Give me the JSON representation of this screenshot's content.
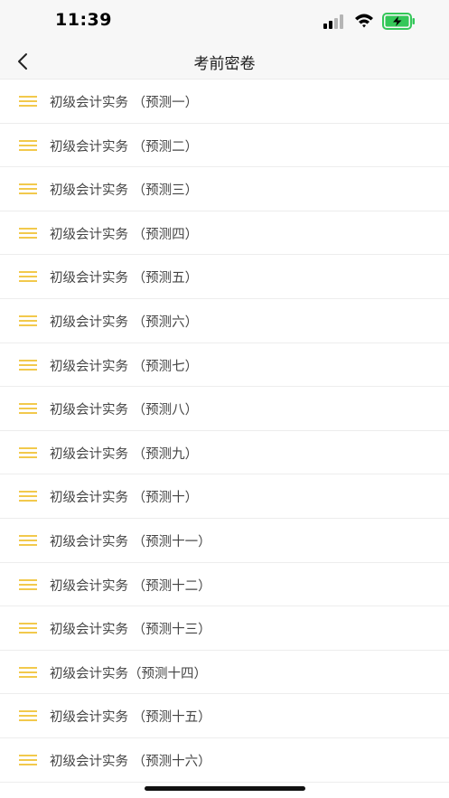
{
  "status_bar": {
    "time": "11:39",
    "icons": [
      "signal-icon",
      "wifi-icon",
      "battery-charging-icon"
    ],
    "battery_color": "#34c759"
  },
  "nav": {
    "back_icon": "chevron-left-icon",
    "title": "考前密卷"
  },
  "list": {
    "icon": "menu-lines-icon",
    "accent_color": "#f2c94c",
    "items": [
      {
        "label": "初级会计实务 （预测一）"
      },
      {
        "label": "初级会计实务 （预测二）"
      },
      {
        "label": "初级会计实务 （预测三）"
      },
      {
        "label": "初级会计实务 （预测四）"
      },
      {
        "label": "初级会计实务 （预测五）"
      },
      {
        "label": "初级会计实务 （预测六）"
      },
      {
        "label": "初级会计实务 （预测七）"
      },
      {
        "label": "初级会计实务 （预测八）"
      },
      {
        "label": "初级会计实务 （预测九）"
      },
      {
        "label": "初级会计实务 （预测十）"
      },
      {
        "label": "初级会计实务 （预测十一）"
      },
      {
        "label": "初级会计实务 （预测十二）"
      },
      {
        "label": "初级会计实务 （预测十三）"
      },
      {
        "label": "初级会计实务（预测十四）"
      },
      {
        "label": "初级会计实务 （预测十五）"
      },
      {
        "label": "初级会计实务 （预测十六）"
      }
    ]
  }
}
